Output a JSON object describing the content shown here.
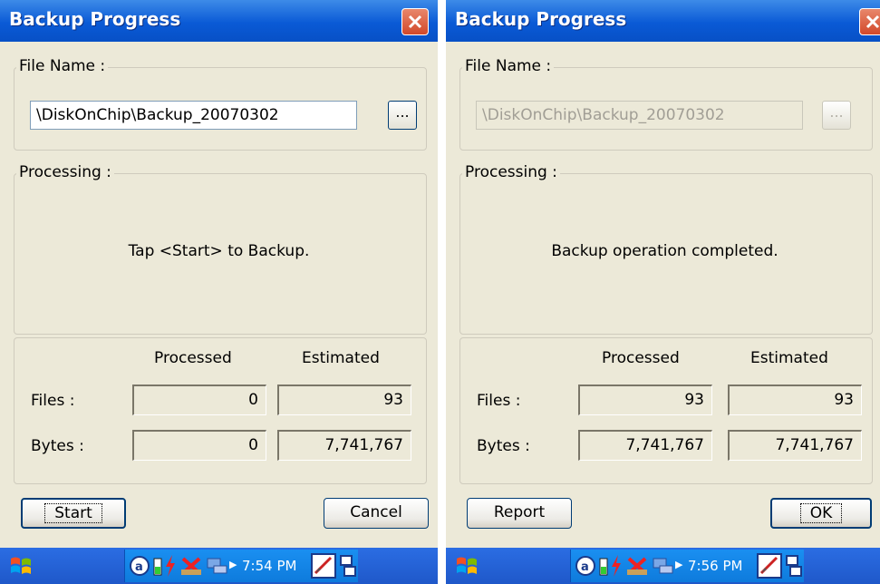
{
  "left": {
    "title": "Backup Progress",
    "file_name_label": "File Name :",
    "file_path": "\\DiskOnChip\\Backup_20070302",
    "browse_label": "...",
    "processing_label": "Processing :",
    "status_message": "Tap <Start> to Backup.",
    "col_processed": "Processed",
    "col_estimated": "Estimated",
    "files_label": "Files :",
    "bytes_label": "Bytes :",
    "files_processed": "0",
    "files_estimated": "93",
    "bytes_processed": "0",
    "bytes_estimated": "7,741,767",
    "button_left": "Start",
    "button_right": "Cancel",
    "clock": "7:54 PM"
  },
  "right": {
    "title": "Backup Progress",
    "file_name_label": "File Name :",
    "file_path": "\\DiskOnChip\\Backup_20070302",
    "browse_label": "...",
    "processing_label": "Processing :",
    "status_message": "Backup operation completed.",
    "col_processed": "Processed",
    "col_estimated": "Estimated",
    "files_label": "Files :",
    "bytes_label": "Bytes :",
    "files_processed": "93",
    "files_estimated": "93",
    "bytes_processed": "7,741,767",
    "bytes_estimated": "7,741,767",
    "button_left": "Report",
    "button_right": "OK",
    "clock": "7:56 PM"
  },
  "colors": {
    "titlebar": "#0a5ad6",
    "dialog_bg": "#ece9d8",
    "close_button": "#d2482a",
    "taskbar": "#2b6de3"
  },
  "icons": [
    "close-icon",
    "start-menu-icon",
    "connectivity-icon",
    "battery-icon",
    "power-icon",
    "network-icon",
    "sync-icon",
    "input-panel-icon",
    "window-switch-icon"
  ]
}
